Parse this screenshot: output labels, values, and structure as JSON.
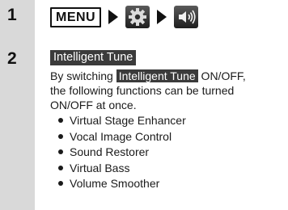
{
  "steps": [
    {
      "number": "1"
    },
    {
      "number": "2"
    }
  ],
  "step1": {
    "menu_key_label": "MENU",
    "icons": [
      "arrow-right-icon",
      "settings-gear-icon",
      "arrow-right-icon",
      "speaker-sound-icon"
    ]
  },
  "step2": {
    "title": "Intelligent Tune",
    "desc_prefix": "By switching ",
    "desc_highlight": "Intelligent Tune",
    "desc_line1_suffix": " ON/OFF,",
    "desc_line2": "the following functions can be turned",
    "desc_line3": "ON/OFF at once.",
    "features": [
      "Virtual Stage Enhancer",
      "Vocal Image Control",
      "Sound Restorer",
      "Virtual Bass",
      "Volume Smoother"
    ]
  },
  "colors": {
    "sidebar": "#d9d9d9",
    "highlight_bg": "#3b3b3b",
    "highlight_text": "#ffffff",
    "text": "#1a1a1a"
  }
}
